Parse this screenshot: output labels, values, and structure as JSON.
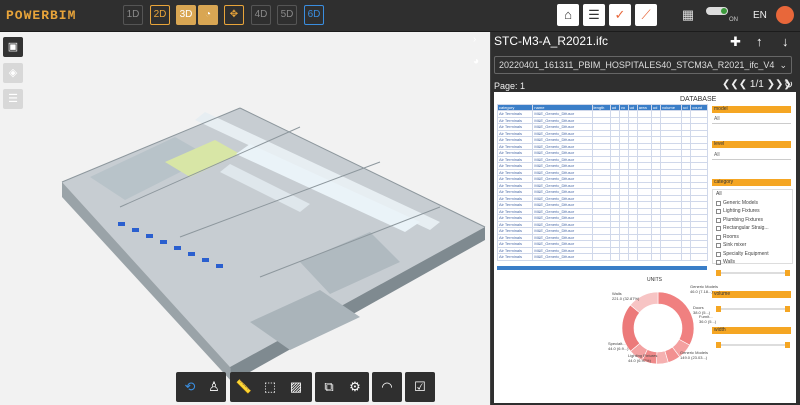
{
  "app": {
    "logo": "POWERBIM",
    "lang": "EN"
  },
  "dimensions": [
    "1D",
    "2D",
    "3D",
    "4D",
    "5D",
    "6D"
  ],
  "toggle_label": "ON",
  "panel": {
    "title": "STC-M3-A_R2021.ifc",
    "file": "20220401_161311_PBIM_HOSPITALES40_STCM3A_R2021_ifc_V4",
    "page_label": "Page: 1",
    "page_nav": "1/1"
  },
  "report": {
    "db_title": "DATABASE",
    "columns": [
      "category",
      "name",
      "length",
      "ud",
      "vo",
      "ud",
      "area",
      "ud",
      "volume",
      "ud",
      "count"
    ],
    "rows": [
      {
        "category": "Air Terminals",
        "name": "M&E_Generic_Difusor"
      },
      {
        "category": "Air Terminals",
        "name": "M&E_Generic_Difusor"
      },
      {
        "category": "Air Terminals",
        "name": "M&E_Generic_Difusor"
      },
      {
        "category": "Air Terminals",
        "name": "M&E_Generic_Difusor"
      },
      {
        "category": "Air Terminals",
        "name": "M&E_Generic_Difusor"
      },
      {
        "category": "Air Terminals",
        "name": "M&E_Generic_Difusor"
      },
      {
        "category": "Air Terminals",
        "name": "M&E_Generic_Difusor"
      },
      {
        "category": "Air Terminals",
        "name": "M&E_Generic_Difusor"
      },
      {
        "category": "Air Terminals",
        "name": "M&E_Generic_Difusor"
      },
      {
        "category": "Air Terminals",
        "name": "M&E_Generic_Difusor"
      },
      {
        "category": "Air Terminals",
        "name": "M&E_Generic_Difusor"
      },
      {
        "category": "Air Terminals",
        "name": "M&E_Generic_Difusor"
      },
      {
        "category": "Air Terminals",
        "name": "M&E_Generic_Difusor"
      },
      {
        "category": "Air Terminals",
        "name": "M&E_Generic_Difusor"
      },
      {
        "category": "Air Terminals",
        "name": "M&E_Generic_Difusor"
      },
      {
        "category": "Air Terminals",
        "name": "M&E_Generic_Difusor"
      },
      {
        "category": "Air Terminals",
        "name": "M&E_Generic_Difusor"
      },
      {
        "category": "Air Terminals",
        "name": "M&E_Generic_Difusor"
      },
      {
        "category": "Air Terminals",
        "name": "M&E_Generic_Difusor"
      },
      {
        "category": "Air Terminals",
        "name": "M&E_Generic_Difusor"
      },
      {
        "category": "Air Terminals",
        "name": "M&E_Generic_Difusor"
      },
      {
        "category": "Air Terminals",
        "name": "M&E_Generic_Difusor"
      },
      {
        "category": "Air Terminals",
        "name": "M&E_Generic_Difusor"
      }
    ]
  },
  "filters": {
    "model": {
      "label": "model",
      "value": "All"
    },
    "level": {
      "label": "level",
      "value": "All"
    },
    "category": {
      "label": "category",
      "value": "All",
      "items": [
        "Generic Models",
        "Lighting Fixtures",
        "Plumbing Fixtures",
        "Rectangular Straig...",
        "Rooms",
        "Sink mixer",
        "Specialty Equipment",
        "Walls"
      ]
    },
    "volume": {
      "label": "volume"
    },
    "width": {
      "label": "width"
    }
  },
  "units": {
    "title": "UNITS",
    "labels": [
      {
        "text": "Walls\n221.0 (32.87%)"
      },
      {
        "text": "Generic Models\n46.0 (7.18...)"
      },
      {
        "text": "Doors\n38.0 (5...)"
      },
      {
        "text": "Furnit...\n36.0 (5...)"
      },
      {
        "text": "Specialt...\n44.0 (6.9...)"
      },
      {
        "text": "Lighting Fixtures\n44.0 (6.97%)"
      },
      {
        "text": "Generic Models\n149.0 (23.03...)"
      }
    ]
  },
  "chart_data": {
    "type": "pie",
    "title": "UNITS",
    "categories": [
      "Walls",
      "Generic Models (A)",
      "Doors",
      "Furnit...",
      "Specialt...",
      "Lighting Fixtures",
      "Generic Models (B)",
      "Other"
    ],
    "values": [
      221,
      46,
      38,
      36,
      44,
      44,
      149,
      94
    ],
    "colors": [
      "#f08080",
      "#f4a0a0",
      "#f29090",
      "#f5b0b0",
      "#ef8a8a",
      "#f3a2a2",
      "#ec7a7a",
      "#f7c4c4"
    ]
  }
}
